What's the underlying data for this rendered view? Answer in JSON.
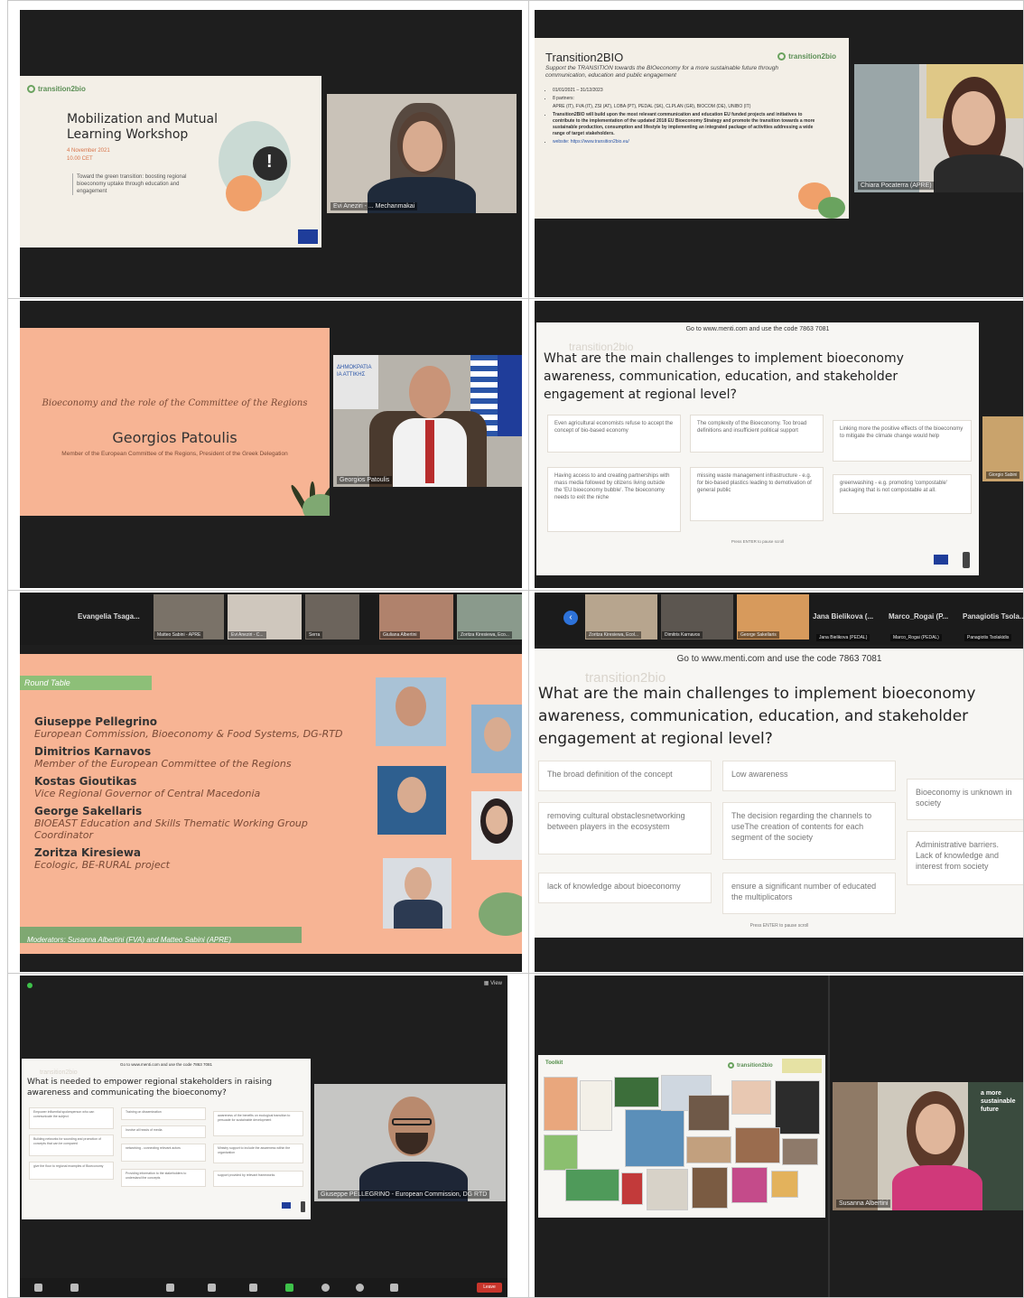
{
  "cell1": {
    "logo": "transition2bio",
    "title": "Mobilization and Mutual Learning Workshop",
    "date": "4 November 2021",
    "time": "10.00 CET",
    "subtitle": "Toward the green transition: boosting regional bioeconomy uptake through education and engagement",
    "speaker_label": "Evi Aneziri - ... Mechanmakai"
  },
  "cell2": {
    "title": "Transition2BIO",
    "logo": "transition2bio",
    "subtitle": "Support the TRANSITION towards the BIOeconomy for a more sustainable future through communication, education and public engagement",
    "bullets": [
      "01/01/2021 – 31/12/2023",
      "8 partners:",
      "APRE (IT), FVA (IT), ZSI (AT), LOBA (PT), PEDAL (SK), CLPLAN (GR), BIOCOM (DE), UNIBO (IT)",
      "Transition2BIO will build upon the most relevant communication and education EU funded projects and initiatives to contribute to the implementation of the updated 2018 EU Bioeconomy Strategy and promote the transition towards a more sustainable production, consumption and lifestyle by implementing an integrated package of activities addressing a wide range of target stakeholders.",
      "website: https://www.transition2bio.eu/"
    ],
    "speaker_label": "Chiara Pocaterra (APRE)"
  },
  "cell3": {
    "topic": "Bioeconomy and the role of the Committee of the Regions",
    "name": "Georgios Patoulis",
    "role": "Member of the European Committee of the Regions, President of the Greek Delegation",
    "flag_text": "ΔΗΜΟΚΡΑΤΙΑ ΙΑ ΑΤΤΙΚΗΣ",
    "speaker_label": "Georgios Patoulis"
  },
  "cell4": {
    "code_line": "Go to www.menti.com and use the code 7863 7081",
    "watermark": "transition2bio",
    "question": "What are the main challenges to implement bioeconomy awareness, communication, education, and stakeholder engagement at regional level?",
    "answers": [
      "Even agricultural economists refuse to accept the concept of bio-based economy",
      "The complexity of the Bioeconomy. Too broad definitions and insufficient political support",
      "Linking more the positive effects of the bioeconomy to mitigate the climate change would help",
      "Having access to and creating partnerships with mass media followed by citizens living outside the 'EU bioeconomy bubble'. The bioeconomy needs to exit the niche",
      "missing waste management infrastructure - e.g. for bio-based plastics leading to demotivation of general public",
      "greenwashing - e.g. promoting 'compostable' packaging that is not compostable at all."
    ],
    "footer": "Press ENTER to pause scroll",
    "speaker_label": "Giorgio Sabini"
  },
  "cell5": {
    "strip": [
      {
        "name": "Evangelia Tsaga...",
        "label": "Evangelia Tsagarakis (G..."
      },
      {
        "name": "",
        "label": "Matteo Sabini - APRE"
      },
      {
        "name": "",
        "label": "Evi Aneziri - C..."
      },
      {
        "name": "",
        "label": "Serra"
      },
      {
        "name": "",
        "label": "Giuliana Albertini"
      },
      {
        "name": "",
        "label": "Zoritza Kiresiewa, Eco..."
      }
    ],
    "tag": "Round Table",
    "speakers": [
      {
        "name": "Giuseppe Pellegrino",
        "role": "European Commission, Bioeconomy & Food Systems, DG-RTD"
      },
      {
        "name": "Dimitrios Karnavos",
        "role": "Member of the European Committee of the Regions"
      },
      {
        "name": "Kostas Gioutikas",
        "role": "Vice Regional Governor of Central Macedonia"
      },
      {
        "name": "George Sakellaris",
        "role": "BIOEAST Education and Skills Thematic Working Group Coordinator"
      },
      {
        "name": "Zoritza Kiresiewa",
        "role": "Ecologic, BE-RURAL project"
      }
    ],
    "moderators": "Moderators: Susanna Albertini (FVA) and Matteo Sabini (APRE)"
  },
  "cell6": {
    "strip": [
      {
        "name": "",
        "label": "Zoritza Kiresiewa, Ecol..."
      },
      {
        "name": "",
        "label": "Dimitris Karnavos"
      },
      {
        "name": "",
        "label": "George Sakellaris"
      },
      {
        "name": "Jana Bielikova (...",
        "label": "Jana Bielikova (PEDAL)"
      },
      {
        "name": "Marco_Rogai (P...",
        "label": "Marco_Rogai (PEDAL)"
      },
      {
        "name": "Panagiotis Tsola...",
        "label": "Panagiotis Tsolakidis"
      }
    ],
    "code_line": "Go to www.menti.com and use the code 7863 7081",
    "watermark": "transition2bio",
    "question": "What are the main challenges to implement bioeconomy awareness, communication, education, and stakeholder engagement at regional level?",
    "answers": [
      "The broad definition of the concept",
      "Low awareness",
      "Bioeconomy is unknown in society",
      "removing cultural obstaclesnetworking between players in the ecosystem",
      "The decision regarding the channels to useThe creation of contents for each segment of the society",
      "Administrative barriers. Lack of knowledge and interest from society",
      "lack of knowledge about bioeconomy",
      "ensure a significant number of educated the multiplicators"
    ],
    "footer": "Press ENTER to pause scroll"
  },
  "cell7": {
    "code_line": "Go to www.menti.com and use the code 7863 7081",
    "watermark": "transition2bio",
    "question": "What is needed to empower regional stakeholders in raising awareness and communicating the bioeconomy?",
    "answers": [
      "Empower influential spokesperson who can communicate the subject",
      "Training on dissemination",
      "awareness of the benefits on ecological transition to persuade for sustainable development",
      "Building networks for sounding and promotion of concepts that can be compared",
      "Involve all heads of media",
      "networking - connecting relevant actors",
      "Ministry support to include the awareness within the organization",
      "give the floor to regional examples of Bioeconomy",
      "Providing information to the stakeholders to understand the concepts",
      "support provided by relevant frameworks"
    ],
    "speaker_label": "Giuseppe PELLEGRINO - European Commission, DG RTD",
    "view_label": "View",
    "leave_label": "Leave"
  },
  "cell8": {
    "tag": "Toolkit",
    "logo": "transition2bio",
    "right_panel_text": "a more sustainable future",
    "speaker_label": "Susanna Albertini"
  },
  "colors": {
    "peach": "#f7b494",
    "beige": "#f3efe7",
    "dark": "#1e1e1e",
    "accent_green": "#6aa35f",
    "meeting_red": "#c8352b"
  }
}
